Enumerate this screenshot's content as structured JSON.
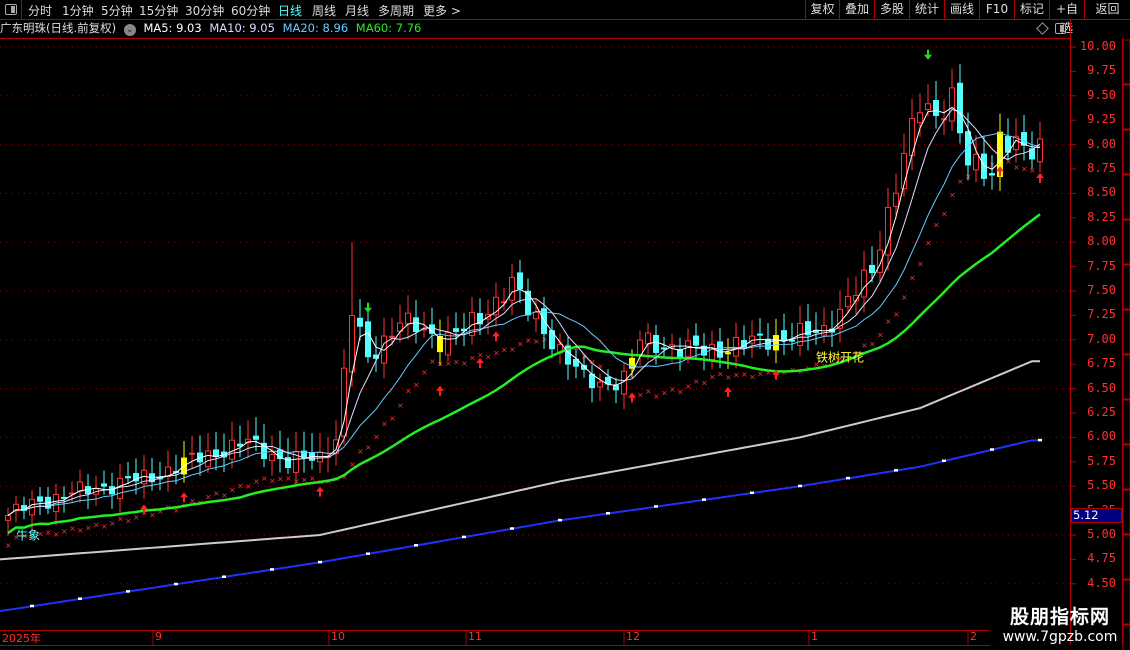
{
  "toolbar": {
    "periods": [
      "分时",
      "1分钟",
      "5分钟",
      "15分钟",
      "30分钟",
      "60分钟",
      "日线",
      "周线",
      "月线",
      "多周期",
      "更多 >"
    ],
    "active_period": "日线",
    "buttons": [
      "复权",
      "叠加",
      "多股",
      "统计",
      "画线",
      "F10",
      "标记",
      "+自选",
      "返回"
    ]
  },
  "info": {
    "title": "广东明珠(日线.前复权)",
    "ma5": "MA5: 9.03",
    "ma10": "MA10: 9.05",
    "ma20": "MA20: 8.96",
    "ma60": "MA60: 7.76"
  },
  "colors": {
    "up": "#ff3232",
    "down": "#54ffff",
    "ma5": "#ffffff",
    "ma10": "#ddddff",
    "ma20": "#66ccff",
    "ma60": "#22ee22",
    "grid": "#b00000",
    "signal": "#ffff00"
  },
  "price_axis": [
    "10.00",
    "9.75",
    "9.50",
    "9.25",
    "9.00",
    "8.75",
    "8.50",
    "8.25",
    "8.00",
    "7.75",
    "7.50",
    "7.25",
    "7.00",
    "6.75",
    "6.50",
    "6.25",
    "6.00",
    "5.75",
    "5.50",
    "5.25",
    "5.00",
    "4.75",
    "4.50"
  ],
  "crosshair_price": "5.12",
  "dates": [
    "2025年",
    "9",
    "10",
    "11",
    "12",
    "1",
    "2"
  ],
  "chart_data": {
    "type": "candlestick",
    "ylim": [
      4.4,
      10.1
    ],
    "candle_count": 130,
    "close_anchors": [
      [
        0,
        5.2
      ],
      [
        4,
        5.35
      ],
      [
        12,
        5.5
      ],
      [
        18,
        5.6
      ],
      [
        24,
        5.8
      ],
      [
        30,
        5.95
      ],
      [
        35,
        5.75
      ],
      [
        39,
        5.8
      ],
      [
        41,
        6.0
      ],
      [
        43,
        7.3
      ],
      [
        45,
        6.8
      ],
      [
        47,
        7.0
      ],
      [
        49,
        7.2
      ],
      [
        54,
        7.0
      ],
      [
        59,
        7.2
      ],
      [
        63,
        7.6
      ],
      [
        65,
        7.3
      ],
      [
        69,
        6.9
      ],
      [
        72,
        6.6
      ],
      [
        74,
        6.55
      ],
      [
        77,
        6.6
      ],
      [
        79,
        7.0
      ],
      [
        84,
        6.9
      ],
      [
        89,
        6.9
      ],
      [
        94,
        7.0
      ],
      [
        99,
        7.05
      ],
      [
        102,
        7.1
      ],
      [
        105,
        7.4
      ],
      [
        108,
        7.7
      ],
      [
        110,
        8.3
      ],
      [
        112,
        8.9
      ],
      [
        114,
        9.4
      ],
      [
        116,
        9.3
      ],
      [
        118,
        9.5
      ],
      [
        120,
        8.8
      ],
      [
        123,
        8.7
      ],
      [
        124,
        9.1
      ],
      [
        126,
        9.0
      ],
      [
        128,
        8.9
      ],
      [
        129,
        8.95
      ]
    ],
    "spike_high_index": 43,
    "spike_high": 8.0,
    "long_ma_gray": [
      [
        0,
        4.75
      ],
      [
        40,
        5.0
      ],
      [
        70,
        5.55
      ],
      [
        100,
        6.0
      ],
      [
        115,
        6.3
      ],
      [
        129,
        6.78
      ]
    ],
    "long_ma_blue": [
      [
        0,
        4.22
      ],
      [
        40,
        4.72
      ],
      [
        70,
        5.15
      ],
      [
        100,
        5.5
      ],
      [
        115,
        5.7
      ],
      [
        129,
        5.97
      ]
    ],
    "up_arrows": [
      17,
      22,
      39,
      54,
      59,
      61,
      78,
      90,
      96,
      124,
      129
    ],
    "down_arrows": [
      45,
      115
    ],
    "labels": [
      {
        "index": 2,
        "text": "牛象"
      },
      {
        "index": 101,
        "text": "铁树开花"
      }
    ]
  }
}
